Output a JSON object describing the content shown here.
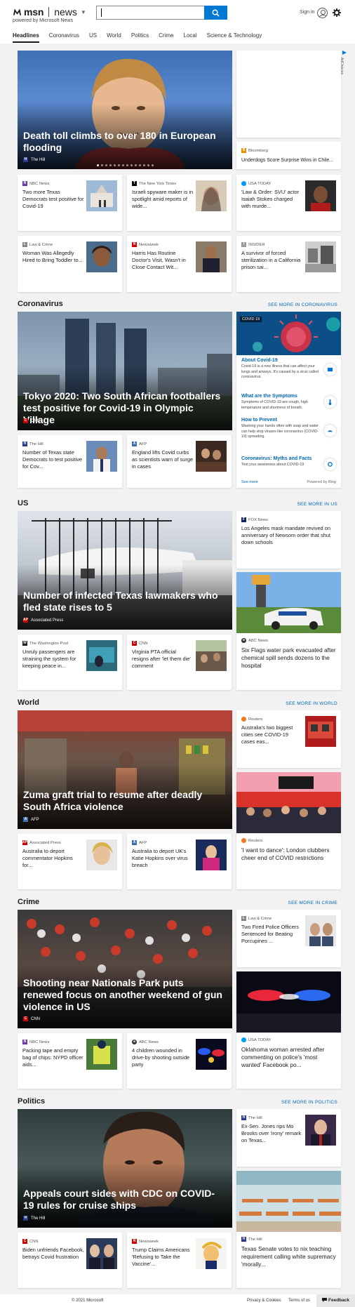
{
  "header": {
    "brand": "msn",
    "section": "news",
    "powered_by": "powered by Microsoft News",
    "search_placeholder": "",
    "sign_in": "Sign in",
    "nav": [
      "Headlines",
      "Coronavirus",
      "US",
      "World",
      "Politics",
      "Crime",
      "Local",
      "Science & Technology"
    ],
    "active_nav": "Headlines"
  },
  "top": {
    "hero": {
      "title": "Death toll climbs to over 180 in European flooding",
      "source": "The Hill",
      "slides": 14,
      "active_slide": 1
    },
    "ad": {
      "label": "AdChoices"
    },
    "side": {
      "source": "Bloomberg",
      "title": "Underdogs Score Surprise Wins in Chile..."
    },
    "cards": [
      {
        "source": "NBC News",
        "title": "Two more Texas Democrats test positive for Covid-19"
      },
      {
        "source": "The New York Times",
        "title": "Israeli spyware maker is in spotlight amid reports of wide..."
      },
      {
        "source": "USA TODAY",
        "title": "'Law & Order: SVU' actor Isaiah Stokes charged with murde..."
      },
      {
        "source": "Law & Crime",
        "title": "Woman Was Allegedly Hired to Bring Toddler to..."
      },
      {
        "source": "Newsweek",
        "title": "Harris Has Routine Doctor's Visit, Wasn't in Close Contact Wit..."
      },
      {
        "source": "INSIDER",
        "title": "A survivor of forced sterilization in a California prison sai..."
      }
    ]
  },
  "coronavirus": {
    "title": "Coronavirus",
    "see_more": "SEE MORE IN CORONAVIRUS",
    "hero": {
      "title": "Tokyo 2020: Two South African footballers test positive for Covid-19 in Olympic Village",
      "source": "CNN"
    },
    "cards": [
      {
        "source": "The Hill",
        "title": "Number of Texas state Democrats to test positive for Cov..."
      },
      {
        "source": "AFP",
        "title": "England lifts Covid curbs as scientists warn of surge in cases"
      }
    ],
    "panel": {
      "tag": "COVID 19",
      "items": [
        {
          "heading": "About Covid-19",
          "desc": "Covid-19 is a new illness that can affect your lungs and airways. It's caused by a virus called coronavirus."
        },
        {
          "heading": "What are the Symptoms",
          "desc": "Symptoms of COVID-19 are cough, high temperature and shortness of breath."
        },
        {
          "heading": "How to Prevent",
          "desc": "Washing your hands often with soap and water can help stop viruses like coronavirus (COVID-19) spreading."
        },
        {
          "heading": "Coronavirus: Myths and Facts",
          "desc": "Test your awareness about COVID-19"
        }
      ],
      "see_more": "See more",
      "powered": "Powered by Bing"
    }
  },
  "us": {
    "title": "US",
    "see_more": "SEE MORE IN US",
    "hero": {
      "title": "Number of infected Texas lawmakers who fled state rises to 5",
      "source": "Associated Press"
    },
    "side_top": {
      "source": "FOX News",
      "title": "Los Angeles mask mandate revived on anniversary of Newsom order that shut down schools"
    },
    "side_big": {
      "source": "ABC News",
      "title": "Six Flags water park evacuated after chemical spill sends dozens to the hospital"
    },
    "cards": [
      {
        "source": "The Washington Post",
        "title": "Unruly passengers are straining the system for keeping peace in..."
      },
      {
        "source": "CNN",
        "title": "Virginia PTA official resigns after 'let them die' comment"
      }
    ]
  },
  "world": {
    "title": "World",
    "see_more": "SEE MORE IN WORLD",
    "hero": {
      "title": "Zuma graft trial to resume after deadly South Africa violence",
      "source": "AFP"
    },
    "side_top": {
      "source": "Reuters",
      "title": "Australia's two biggest cities see COVID-19 cases eas..."
    },
    "side_big": {
      "source": "Reuters",
      "title": "'I want to dance': London clubbers cheer end of COVID restrictions"
    },
    "cards": [
      {
        "source": "Associated Press",
        "title": "Australia to deport commentator Hopkins for..."
      },
      {
        "source": "AFP",
        "title": "Australia to deport UK's Katie Hopkins over virus breach"
      }
    ]
  },
  "crime": {
    "title": "Crime",
    "see_more": "SEE MORE IN CRIME",
    "hero": {
      "title": "Shooting near Nationals Park puts renewed focus on another weekend of gun violence in US",
      "source": "CNN"
    },
    "side_top": {
      "source": "Law & Crime",
      "title": "Two Fired Police Officers Sentenced for Beating Porcupines ..."
    },
    "side_big": {
      "source": "USA TODAY",
      "title": "Oklahoma woman arrested after commenting on police's 'most wanted' Facebook po..."
    },
    "cards": [
      {
        "source": "NBC News",
        "title": "Packing tape and empty bag of chips: NYPD officer aids..."
      },
      {
        "source": "ABC News",
        "title": "4 children wounded in drive-by shooting outside party"
      }
    ]
  },
  "politics": {
    "title": "Politics",
    "see_more": "SEE MORE IN POLITICS",
    "hero": {
      "title": "Appeals court sides with CDC on COVID-19 rules for cruise ships",
      "source": "The Hill"
    },
    "side_top": {
      "source": "The Hill",
      "title": "Ex-Sen. Jones rips Mo Brooks over 'irony' remark on Texas..."
    },
    "side_big": {
      "source": "The Hill",
      "title": "Texas Senate votes to nix teaching requirement calling white supremacy 'morally..."
    },
    "cards": [
      {
        "source": "CNN",
        "title": "Biden unfriends Facebook, betrays Covid frustration"
      },
      {
        "source": "Newsweek",
        "title": "Trump Claims Americans 'Refusing to Take the Vaccine'..."
      }
    ]
  },
  "footer": {
    "copyright": "© 2021 Microsoft",
    "privacy": "Privacy & Cookies",
    "terms": "Terms of us",
    "feedback": "Feedback"
  },
  "colors": {
    "accent": "#0078d4",
    "link": "#0067b8",
    "background": "#f2f2f2",
    "cnn": "#cc0000"
  }
}
